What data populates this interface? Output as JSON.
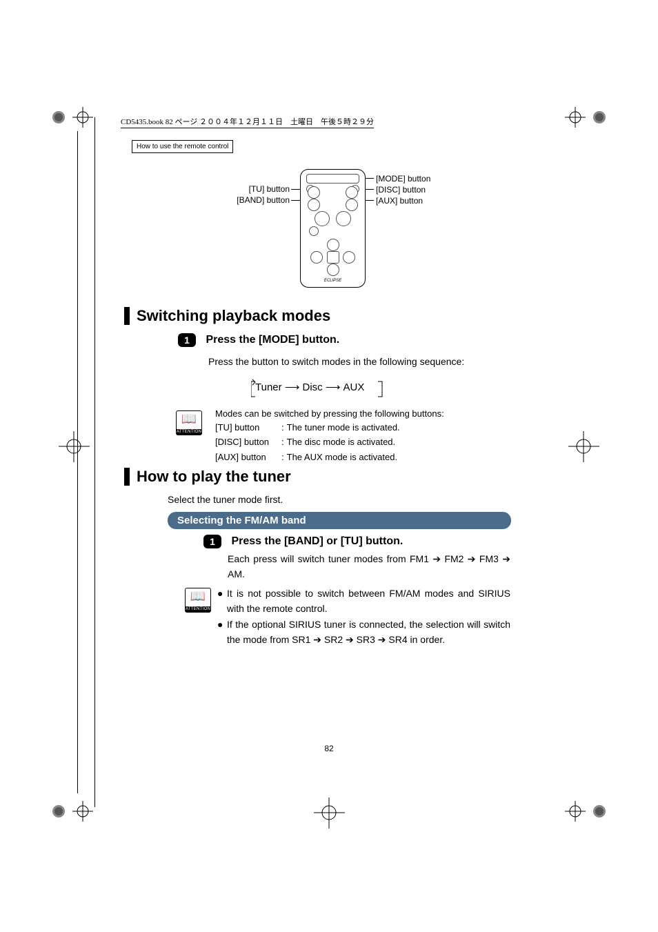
{
  "meta_header": "CD5435.book  82 ページ  ２００４年１２月１１日　土曜日　午後５時２９分",
  "chapter_tab": "How to use the remote control",
  "callouts": {
    "tu": "[TU] button",
    "band": "[BAND] button",
    "mode": "[MODE] button",
    "disc": "[DISC] button",
    "aux": "[AUX] button"
  },
  "section1": {
    "heading": "Switching playback modes",
    "step_num": "1",
    "step_title": "Press the [MODE] button.",
    "intro": "Press the button to switch modes in the following sequence:",
    "seq": {
      "a": "Tuner",
      "b": "Disc",
      "c": "AUX"
    },
    "attention_label": "ATTENTION",
    "attn_intro": "Modes can be switched by pressing the following buttons:",
    "rows": [
      {
        "btn": "[TU] button",
        "colon": ":",
        "desc": "The tuner mode is activated."
      },
      {
        "btn": "[DISC] button",
        "colon": ":",
        "desc": "The disc mode is activated."
      },
      {
        "btn": "[AUX] button",
        "colon": ":",
        "desc": "The AUX mode is activated."
      }
    ]
  },
  "section2": {
    "heading": "How to play the tuner",
    "intro": "Select the tuner mode first.",
    "pill": "Selecting the FM/AM band",
    "step_num": "1",
    "step_title": "Press the [BAND] or [TU] button.",
    "body": "Each press will switch tuner modes from FM1 ➔ FM2 ➔ FM3 ➔ AM.",
    "attention_label": "ATTENTION",
    "bullets": [
      "It is not possible to switch between FM/AM modes and SIRIUS with the remote control.",
      "If the optional SIRIUS tuner is connected, the selection will switch the mode from SR1 ➔ SR2 ➔ SR3 ➔ SR4 in order."
    ]
  },
  "page_number": "82"
}
